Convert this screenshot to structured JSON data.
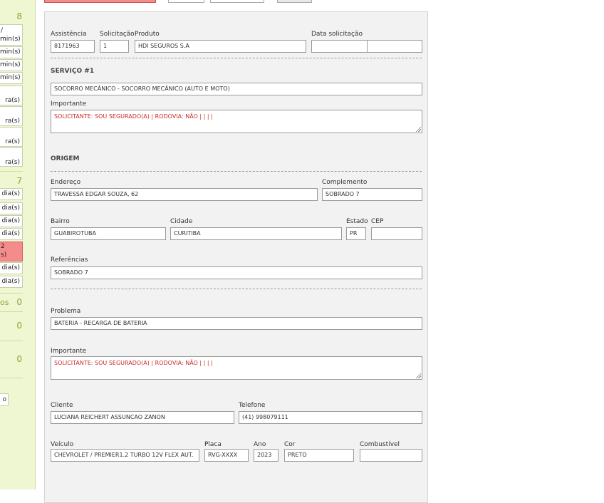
{
  "sidebar": {
    "count_a": "8",
    "slots_a": [
      "min(s)",
      "min(s)",
      "min(s)",
      "min(s)",
      "ra(s)",
      "ra(s)",
      "ra(s)",
      "ra(s)"
    ],
    "slot_a0_top": "/",
    "count_b": "7",
    "slots_b": [
      "dia(s)",
      "dia(s)",
      "dia(s)",
      "dia(s)"
    ],
    "slot_red_line1": "2",
    "slot_red_line2": "s)",
    "slots_c": [
      "dia(s)",
      "dia(s)"
    ],
    "label_os": "os",
    "count_c": "0",
    "count_d": "0",
    "count_e": "0",
    "small_box": "o"
  },
  "form": {
    "assistencia_label": "Assistência",
    "assistencia_value": "8171963",
    "solicitacao_label": "Solicitação",
    "solicitacao_value": "1",
    "produto_label": "Produto",
    "produto_value": "HDI SEGUROS S.A",
    "data_label": "Data solicitação",
    "data_value": "",
    "data_time_value": "",
    "servico_title": "SERVIÇO #1",
    "servico_value": "SOCORRO MECÂNICO - SOCORRO MECÂNICO (AUTO E MOTO)",
    "importante_label": "Importante",
    "importante_value": "SOLICITANTE: SOU SEGURADO(A) | RODOVIA: NÃO |  |  |  |",
    "origem_title": "ORIGEM",
    "endereco_label": "Endereço",
    "endereco_value": "TRAVESSA EDGAR SOUZA, 62",
    "complemento_label": "Complemento",
    "complemento_value": "SOBRADO 7",
    "bairro_label": "Bairro",
    "bairro_value": "GUABIROTUBA",
    "cidade_label": "Cidade",
    "cidade_value": "CURITIBA",
    "estado_label": "Estado",
    "estado_value": "PR",
    "cep_label": "CEP",
    "cep_value": "",
    "referencias_label": "Referências",
    "referencias_value": "SOBRADO 7",
    "problema_label": "Problema",
    "problema_value": "BATERIA - RECARGA DE BATERIA",
    "importante2_label": "Importante",
    "importante2_value": "SOLICITANTE: SOU SEGURADO(A) | RODOVIA: NÃO |  |  |  |",
    "cliente_label": "Cliente",
    "cliente_value": "LUCIANA REICHERT ASSUNCAO ZANON",
    "telefone_label": "Telefone",
    "telefone_value": "(41) 998079111",
    "veiculo_label": "Veículo",
    "veiculo_value": "CHEVROLET / PREMIER1.2 TURBO 12V FLEX AUT.",
    "placa_label": "Placa",
    "placa_value": "RVG-XXXX",
    "ano_label": "Ano",
    "ano_value": "2023",
    "cor_label": "Cor",
    "cor_value": "PRETO",
    "combustivel_label": "Combustível",
    "combustivel_value": ""
  },
  "colors": {
    "sidebar_bg": "#eef6d2",
    "count_green": "#8aa532",
    "alert_red": "#f58c8c",
    "important_text": "#cc2a2a"
  }
}
